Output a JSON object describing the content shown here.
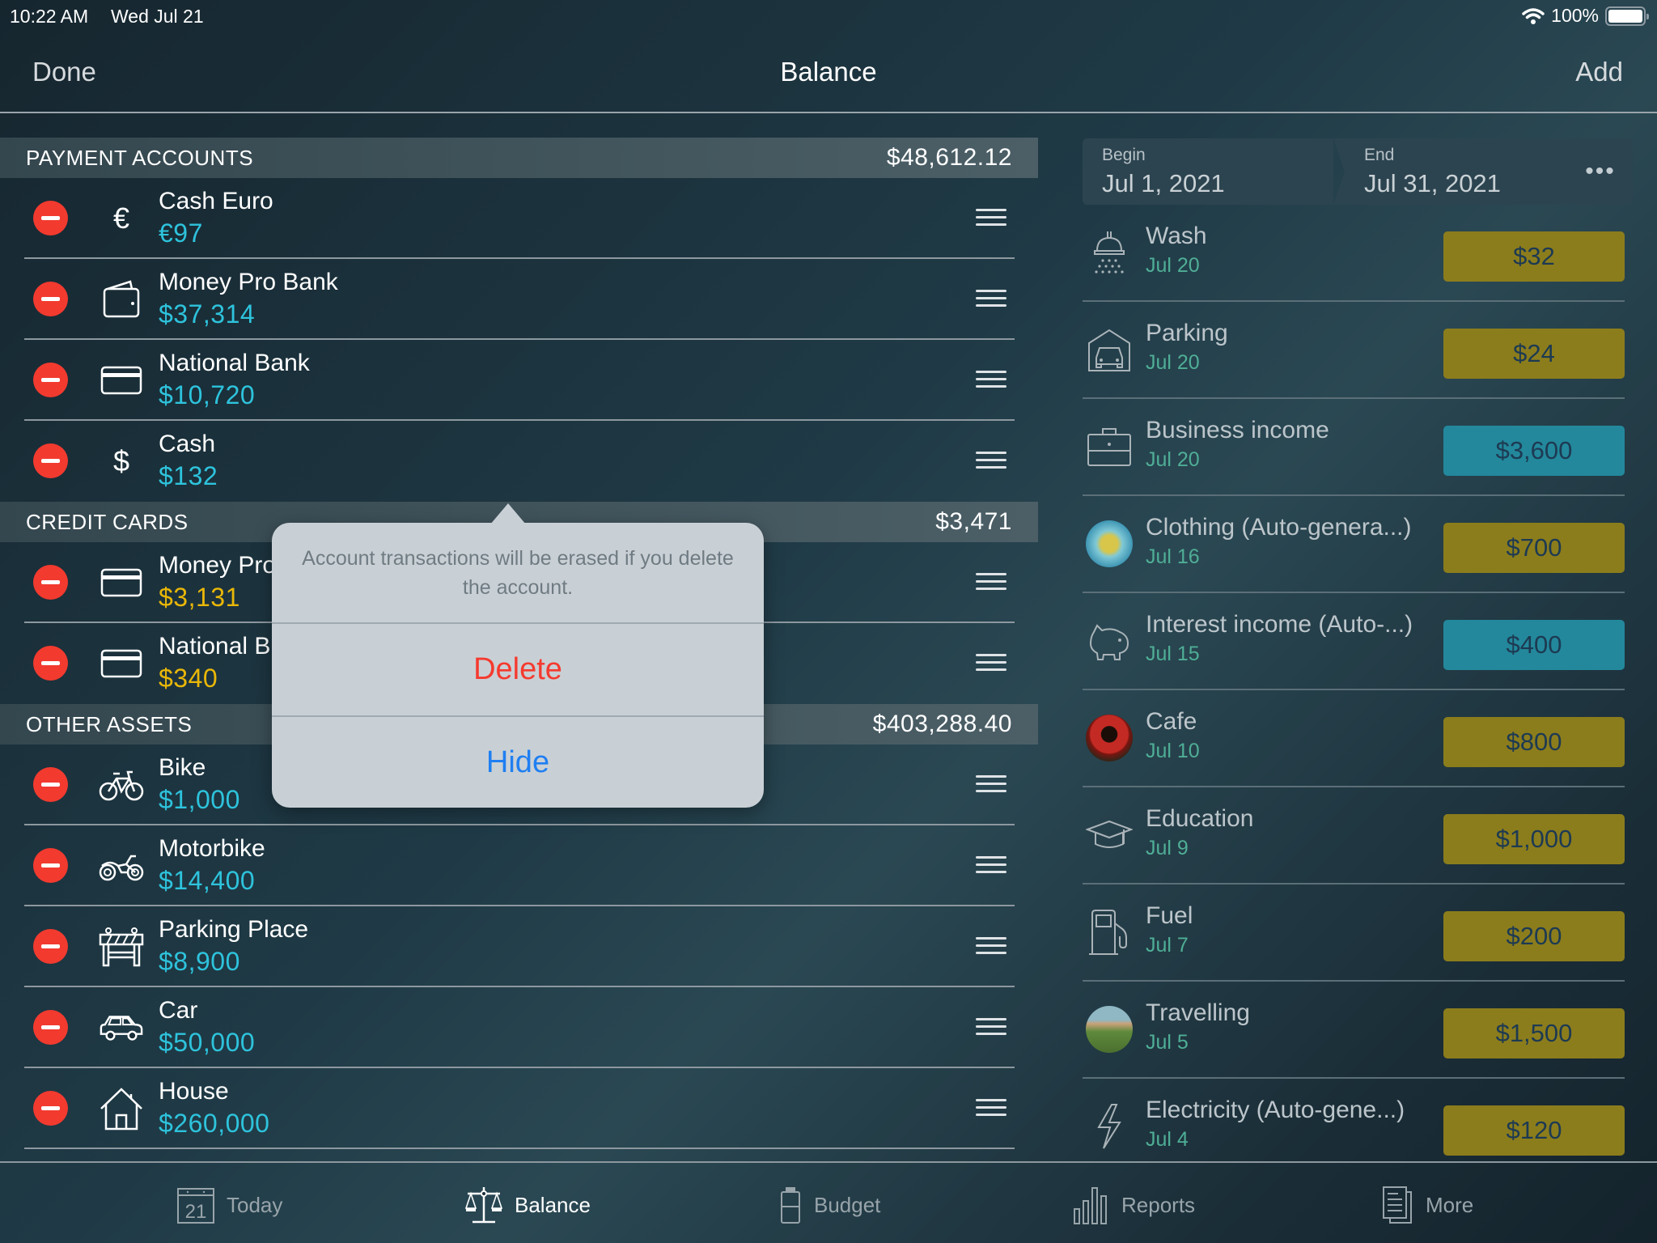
{
  "status_bar": {
    "time": "10:22 AM",
    "date": "Wed Jul 21",
    "battery": "100%",
    "battery_level": 1.0
  },
  "nav": {
    "done_label": "Done",
    "title": "Balance",
    "add_label": "Add"
  },
  "sections": [
    {
      "title": "PAYMENT ACCOUNTS",
      "total": "$48,612.12",
      "accounts": [
        {
          "name": "Cash Euro",
          "amount": "€97",
          "icon": "euro-icon"
        },
        {
          "name": "Money Pro Bank",
          "amount": "$37,314",
          "icon": "wallet-icon"
        },
        {
          "name": "National Bank",
          "amount": "$10,720",
          "icon": "card-icon"
        },
        {
          "name": "Cash",
          "amount": "$132",
          "icon": "dollar-icon"
        }
      ]
    },
    {
      "title": "CREDIT CARDS",
      "total": "$3,471",
      "accounts": [
        {
          "name": "Money Pro",
          "amount": "$3,131",
          "icon": "card-icon"
        },
        {
          "name": "National B",
          "amount": "$340",
          "icon": "card-icon"
        }
      ]
    },
    {
      "title": "OTHER ASSETS",
      "total": "$403,288.40",
      "accounts": [
        {
          "name": "Bike",
          "amount": "$1,000",
          "icon": "bicycle-icon"
        },
        {
          "name": "Motorbike",
          "amount": "$14,400",
          "icon": "motorbike-icon"
        },
        {
          "name": "Parking Place",
          "amount": "$8,900",
          "icon": "barrier-icon"
        },
        {
          "name": "Car",
          "amount": "$50,000",
          "icon": "car-icon"
        },
        {
          "name": "House",
          "amount": "$260,000",
          "icon": "house-icon"
        }
      ]
    }
  ],
  "popover": {
    "message": "Account transactions will be erased if you delete the account.",
    "delete_label": "Delete",
    "hide_label": "Hide"
  },
  "period": {
    "begin_label": "Begin",
    "begin_value": "Jul 1, 2021",
    "end_label": "End",
    "end_value": "Jul 31, 2021",
    "more_label": "•••"
  },
  "transactions": [
    {
      "name": "Wash",
      "date": "Jul 20",
      "amount": "$32",
      "type": "expense",
      "icon": "shower-icon"
    },
    {
      "name": "Parking",
      "date": "Jul 20",
      "amount": "$24",
      "type": "expense",
      "icon": "garage-icon"
    },
    {
      "name": "Business income",
      "date": "Jul 20",
      "amount": "$3,600",
      "type": "income",
      "icon": "briefcase-icon"
    },
    {
      "name": "Clothing (Auto-genera...)",
      "date": "Jul 16",
      "amount": "$700",
      "type": "expense",
      "icon": "shopping-bags-photo"
    },
    {
      "name": "Interest income (Auto-...)",
      "date": "Jul 15",
      "amount": "$400",
      "type": "income",
      "icon": "piggy-bank-icon"
    },
    {
      "name": "Cafe",
      "date": "Jul 10",
      "amount": "$800",
      "type": "expense",
      "icon": "coffee-cup-photo"
    },
    {
      "name": "Education",
      "date": "Jul 9",
      "amount": "$1,000",
      "type": "expense",
      "icon": "graduation-cap-icon"
    },
    {
      "name": "Fuel",
      "date": "Jul 7",
      "amount": "$200",
      "type": "expense",
      "icon": "fuel-pump-icon"
    },
    {
      "name": "Travelling",
      "date": "Jul 5",
      "amount": "$1,500",
      "type": "expense",
      "icon": "landscape-photo"
    },
    {
      "name": "Electricity (Auto-gene...)",
      "date": "Jul 4",
      "amount": "$120",
      "type": "expense",
      "icon": "lightning-icon"
    }
  ],
  "tabs": [
    {
      "label": "Today",
      "icon": "calendar-icon",
      "calendar_day": "21",
      "active": false
    },
    {
      "label": "Balance",
      "icon": "scales-icon",
      "active": true
    },
    {
      "label": "Budget",
      "icon": "budget-jar-icon",
      "active": false
    },
    {
      "label": "Reports",
      "icon": "bar-chart-icon",
      "active": false
    },
    {
      "label": "More",
      "icon": "documents-icon",
      "active": false
    }
  ],
  "colors": {
    "delete_red": "#f23a2f",
    "asset_amount": "#2ec3dc",
    "credit_amount": "#e9b708",
    "expense_badge": "#8c7d1c",
    "income_badge": "#23889c",
    "txn_date": "#4fae96",
    "hide_blue": "#1f7ff2"
  }
}
